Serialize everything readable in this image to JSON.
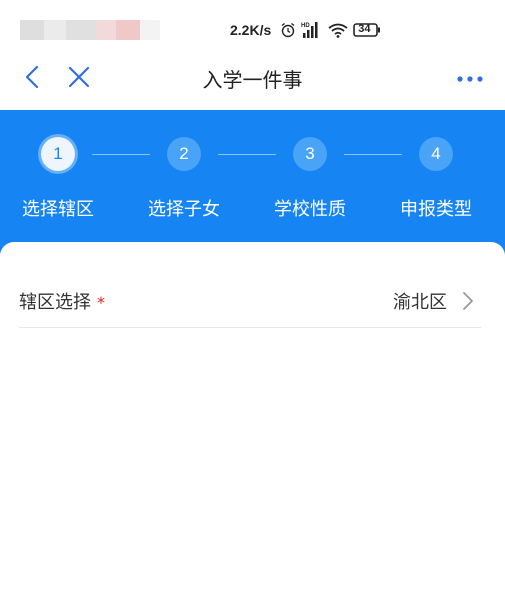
{
  "status_bar": {
    "speed": "2.2K/s",
    "battery": "34",
    "icons": [
      "alarm-icon",
      "hd-signal-icon",
      "wifi-icon",
      "battery-icon"
    ]
  },
  "nav": {
    "title": "入学一件事",
    "icons": [
      "back-icon",
      "close-icon",
      "more-icon"
    ]
  },
  "steps": [
    {
      "number": "1",
      "label": "选择辖区",
      "active": true
    },
    {
      "number": "2",
      "label": "选择子女",
      "active": false
    },
    {
      "number": "3",
      "label": "学校性质",
      "active": false
    },
    {
      "number": "4",
      "label": "申报类型",
      "active": false
    }
  ],
  "form": {
    "district_label": "辖区选择",
    "required_mark": "*",
    "district_value": "渝北区"
  },
  "colors": {
    "accent": "#1684f2",
    "step_inactive": "#49a3f7",
    "required": "#e02020"
  }
}
